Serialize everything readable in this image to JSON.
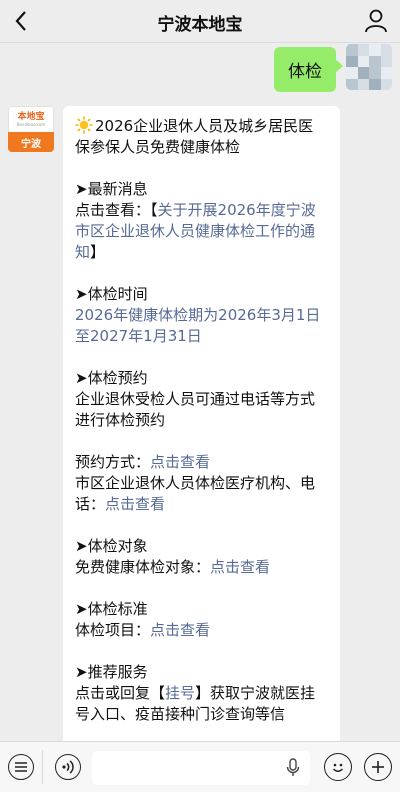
{
  "header": {
    "title": "宁波本地宝",
    "back_icon": "chevron-left-icon",
    "user_icon": "user-icon"
  },
  "outgoing_message": {
    "text": "体检"
  },
  "sender_avatar": {
    "logo": "本地宝",
    "sub": "Bendibao.com",
    "city": "宁波"
  },
  "article": {
    "title": "2026企业退休人员及城乡居民医保参保人员免费健康体检",
    "sections": {
      "news": {
        "heading": "➤最新消息",
        "prefix": "点击查看：",
        "bracket_open": "【",
        "link": "关于开展2026年度宁波市区企业退休人员健康体检工作的通知",
        "bracket_close": "】"
      },
      "time": {
        "heading": "➤体检时间",
        "text": "2026年健康体检期为2026年3月1日至2027年1月31日"
      },
      "booking": {
        "heading": "➤体检预约",
        "text": "企业退休受检人员可通过电话等方式进行体检预约",
        "method_label": "预约方式：",
        "method_link": "点击查看",
        "institution_text": "市区企业退休人员体检医疗机构、电话：",
        "institution_link": "点击查看"
      },
      "target": {
        "heading": "➤体检对象",
        "label": "免费健康体检对象：",
        "link": "点击查看"
      },
      "standard": {
        "heading": "➤体检标准",
        "label": "体检项目：",
        "link": "点击查看"
      },
      "service": {
        "heading": "➤推荐服务",
        "prefix": "点击或回复【",
        "keyword": "挂号",
        "suffix": "】获取宁波就医挂号入口、疫苗接种门诊查询等信"
      }
    }
  },
  "bottom_bar": {
    "icons": [
      "menu-icon",
      "voice-icon",
      "microphone-icon",
      "emoji-icon",
      "plus-icon"
    ]
  },
  "colors": {
    "background": "#ededed",
    "outgoing_bubble": "#95ec69",
    "link": "#576b95",
    "brand_orange": "#f0781e"
  }
}
